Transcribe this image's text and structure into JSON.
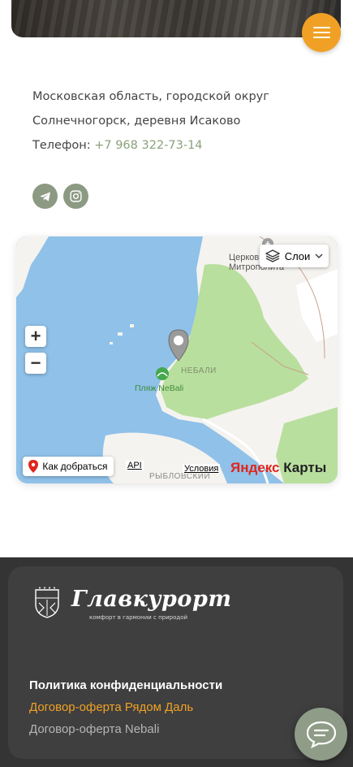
{
  "header": {
    "menu_icon": "hamburger-icon",
    "accent_color": "#f0a125"
  },
  "contacts": {
    "address_line1": "Московская область, городской округ",
    "address_line2": "Солнечногорск, деревня Исаково",
    "phone_label": "Телефон:",
    "phone_value": "+7 968 322-73-14",
    "phone_color": "#8aa07b",
    "social": [
      {
        "name": "telegram",
        "icon": "telegram-icon"
      },
      {
        "name": "instagram",
        "icon": "instagram-icon"
      }
    ],
    "social_color": "#8d9a83"
  },
  "map": {
    "layers_label": "Слои",
    "zoom_in": "+",
    "zoom_out": "−",
    "route_label": "Как добраться",
    "api_label": "API",
    "terms_label": "Условия",
    "logo_part1": "Яндекс",
    "logo_part2": " Карты",
    "place_labels": {
      "church_line1": "Церков",
      "church_line2": "Митрополита",
      "nebali": "НЕБАЛИ",
      "beach": "Пляж NeBali",
      "rybolovsky": "РЫБЛОВСКИЙ"
    },
    "water_color": "#8fc1e9",
    "land_color": "#f5f3ef",
    "forest_color": "#b9df9e"
  },
  "footer": {
    "brand_name": "Главкурорт",
    "brand_tagline": "комфорт в гармонии с природой",
    "links": [
      {
        "label": "Политика конфиденциальности",
        "color": "#ffffff"
      },
      {
        "label": "Договор-оферта Рядом Даль",
        "color": "#f0a125"
      },
      {
        "label": "Договор-оферта Nebali",
        "color": "#b5b5b5"
      }
    ],
    "chat_icon": "chat-icon",
    "chat_color": "#8f9c87"
  }
}
